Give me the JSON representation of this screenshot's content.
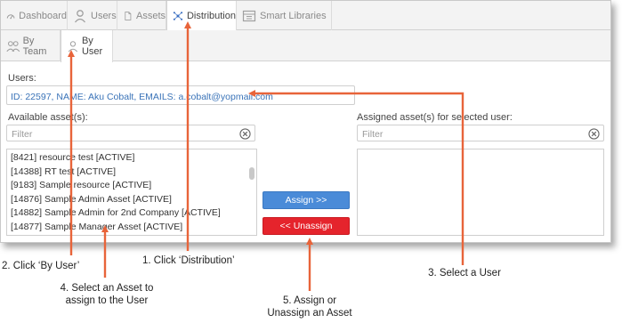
{
  "top_tabs": [
    {
      "label": "Dashboard",
      "icon": "dashboard-icon"
    },
    {
      "label": "Users",
      "icon": "user-icon"
    },
    {
      "label": "Assets",
      "icon": "document-icon"
    },
    {
      "label": "Distribution",
      "icon": "distribution-icon"
    },
    {
      "label": "Smart Libraries",
      "icon": "library-icon"
    }
  ],
  "sub_tabs": [
    {
      "label": "By Team",
      "icon": "team-icon"
    },
    {
      "label": "By User",
      "icon": "user-icon"
    }
  ],
  "users": {
    "label": "Users:",
    "value": "ID: 22597, NAME: Aku Cobalt, EMAILS: a.cobalt@yopmail.com"
  },
  "available": {
    "label": "Available asset(s):",
    "filter_placeholder": "Filter",
    "items": [
      "[8421] resource test [ACTIVE]",
      "[14388] RT test [ACTIVE]",
      "[9183] Sample resource [ACTIVE]",
      "[14876] Sample Admin Asset [ACTIVE]",
      "[14882] Sample Admin for 2nd Company [ACTIVE]",
      "[14877] Sample Manager Asset [ACTIVE]"
    ]
  },
  "assigned": {
    "label": "Assigned asset(s) for selected user:",
    "filter_placeholder": "Filter"
  },
  "buttons": {
    "assign": "Assign >>",
    "unassign": "<< Unassign"
  },
  "annotations": {
    "step1": "1. Click ‘Distribution’",
    "step2": "2. Click ‘By User’",
    "step3": "3. Select a User",
    "step4_line1": "4. Select an Asset to",
    "step4_line2": "assign to the User",
    "step5_line1": "5. Assign or",
    "step5_line2": "Unassign an Asset"
  },
  "colors": {
    "arrow": "#e8643a",
    "assign_button": "#4a8bd8",
    "unassign_button": "#e5242c",
    "link_text": "#3a73b8"
  }
}
